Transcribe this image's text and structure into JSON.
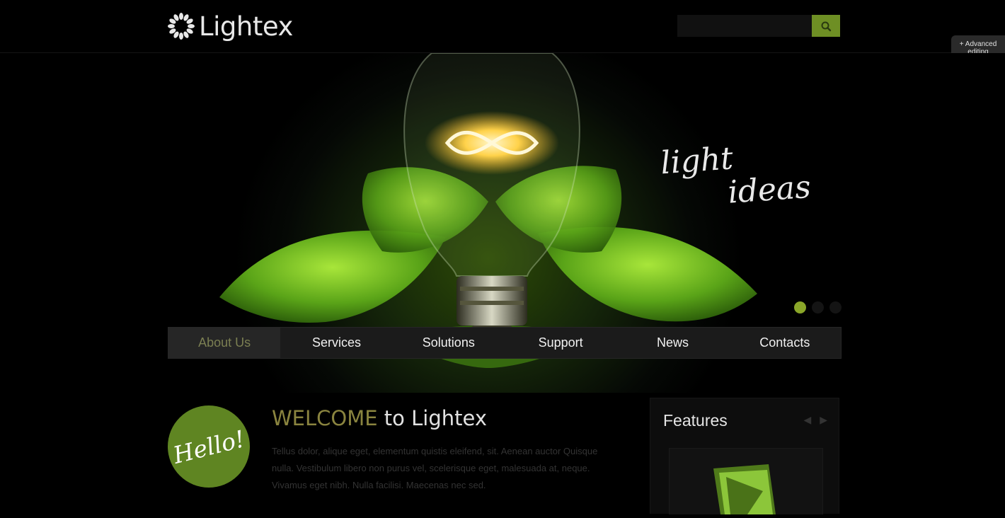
{
  "header": {
    "logo_text": "Lightex",
    "search": {
      "placeholder": "",
      "button_icon": "search-icon"
    }
  },
  "admin": {
    "advanced_editing": "+ Advanced editing"
  },
  "hero": {
    "title_line1": "light",
    "title_line2": "ideas",
    "slide_count": 3,
    "active_slide": 1
  },
  "nav": {
    "items": [
      "About Us",
      "Services",
      "Solutions",
      "Support",
      "News",
      "Contacts"
    ],
    "active": "About Us"
  },
  "main": {
    "hello_badge": "Hello!",
    "welcome_highlight": "WELCOME",
    "welcome_rest": "to Lightex",
    "paragraph": "Tellus dolor, alique eget, elementum quistis eleifend, sit. Aenean auctor Quisque nulla. Vestibulum libero non purus vel, scelerisque eget, malesuada at, neque. Vivamus eget nibh. Nulla facilisi. Maecenas nec sed."
  },
  "features": {
    "title": "Features"
  },
  "colors": {
    "accent": "#6e8f24",
    "nav_active_text": "#7b7f52",
    "welcome_highlight": "#8a843f"
  }
}
